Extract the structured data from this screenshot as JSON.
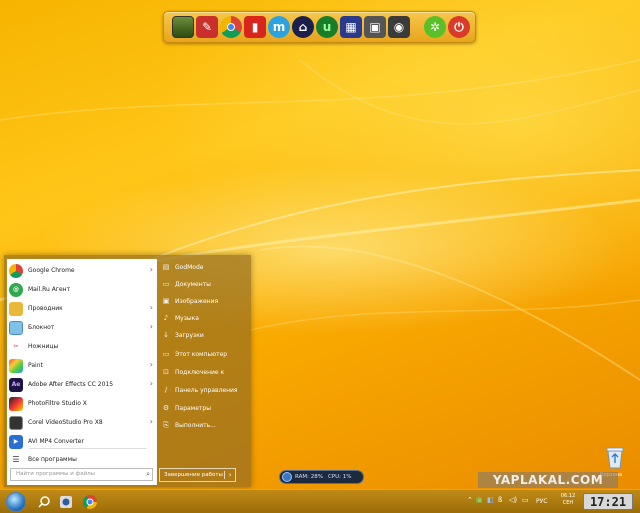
{
  "dock": {
    "icons": [
      "monitor-icon",
      "pdf-reader-icon",
      "chrome-icon",
      "chair-icon",
      "messenger-icon",
      "home-icon",
      "utorrent-icon",
      "clapper-icon",
      "film-icon",
      "speaker-icon",
      "recycle-green-icon",
      "power-icon"
    ]
  },
  "start_menu": {
    "programs": [
      {
        "label": "Google Chrome",
        "icon": "chrome-icon",
        "arrow": true
      },
      {
        "label": "Mail.Ru Агент",
        "icon": "mail-agent-icon",
        "arrow": false
      },
      {
        "label": "Проводник",
        "icon": "folder-icon",
        "arrow": true
      },
      {
        "label": "Блокнот",
        "icon": "notepad-icon",
        "arrow": true
      },
      {
        "label": "Ножницы",
        "icon": "scissors-icon",
        "arrow": false
      },
      {
        "label": "Paint",
        "icon": "paint-icon",
        "arrow": true
      },
      {
        "label": "Adobe After Effects CC 2015",
        "icon": "after-effects-icon",
        "arrow": true
      },
      {
        "label": "PhotoFiltre Studio X",
        "icon": "photofiltre-icon",
        "arrow": false
      },
      {
        "label": "Corel VideoStudio Pro X8",
        "icon": "corel-icon",
        "arrow": true
      },
      {
        "label": "AVI MP4 Converter",
        "icon": "converter-icon",
        "arrow": false
      }
    ],
    "all_programs": "Все программы",
    "search_placeholder": "Найти программы и файлы",
    "right_items": [
      {
        "label": "GodMode",
        "icon": "godmode-icon"
      },
      {
        "label": "Документы",
        "icon": "documents-icon"
      },
      {
        "label": "Изображения",
        "icon": "pictures-icon"
      },
      {
        "label": "Музыка",
        "icon": "music-icon"
      },
      {
        "label": "Загрузки",
        "icon": "downloads-icon"
      },
      {
        "label": "Этот компьютер",
        "icon": "computer-icon"
      },
      {
        "label": "Подключение к",
        "icon": "connect-icon"
      },
      {
        "label": "Панель управления",
        "icon": "control-panel-icon"
      },
      {
        "label": "Параметры",
        "icon": "settings-icon"
      },
      {
        "label": "Выполнить...",
        "icon": "run-icon"
      }
    ],
    "shutdown_label": "Завершение работы",
    "shutdown_arrow": "›"
  },
  "ram_widget": {
    "ram": "RAM: 28%",
    "cpu": "CPU: 1%"
  },
  "desktop": {
    "recycle_label": "Корзина"
  },
  "watermark": "YAPLAKAL.COM",
  "taskbar": {
    "lang": "РУС",
    "date_line1": "06.12",
    "date_line2": "СЕН",
    "clock": "17:21"
  }
}
